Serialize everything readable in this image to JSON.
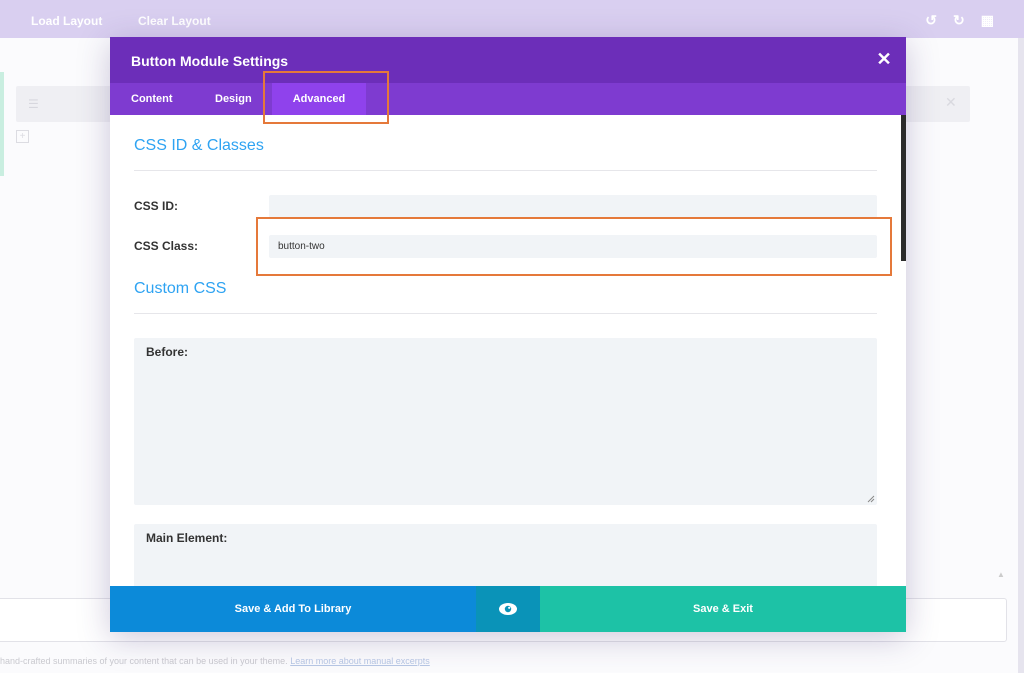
{
  "background": {
    "topbar": {
      "load_layout": "Load Layout",
      "clear_layout": "Clear Layout"
    },
    "icons": [
      "undo-icon",
      "redo-icon",
      "history-icon"
    ],
    "excerpt_note": {
      "text": "hand-crafted summaries of your content that can be used in your theme.",
      "link": "Learn more about manual excerpts"
    }
  },
  "modal": {
    "title": "Button Module Settings",
    "close_icon": "close-icon",
    "tabs": [
      {
        "label": "Content",
        "active": false
      },
      {
        "label": "Design",
        "active": false
      },
      {
        "label": "Advanced",
        "active": true
      }
    ],
    "sections": {
      "css_id_classes": {
        "title": "CSS ID & Classes",
        "css_id": {
          "label": "CSS ID:",
          "value": ""
        },
        "css_class": {
          "label": "CSS Class:",
          "value": "button-two"
        }
      },
      "custom_css": {
        "title": "Custom CSS",
        "before": {
          "label": "Before:",
          "value": ""
        },
        "main_element": {
          "label": "Main Element:",
          "value": ""
        }
      }
    },
    "footer": {
      "save_library": "Save & Add To Library",
      "preview_icon": "eye-icon",
      "save_exit": "Save & Exit"
    }
  },
  "colors": {
    "header": "#6c2eb9",
    "tab_bar": "#7e3bd0",
    "active_tab": "#8f42ec",
    "section_title": "#2ea3f2",
    "save_library": "#0c8ad9",
    "preview": "#0a93b8",
    "save_exit": "#1dc2a6",
    "highlight": "#e5793a"
  }
}
